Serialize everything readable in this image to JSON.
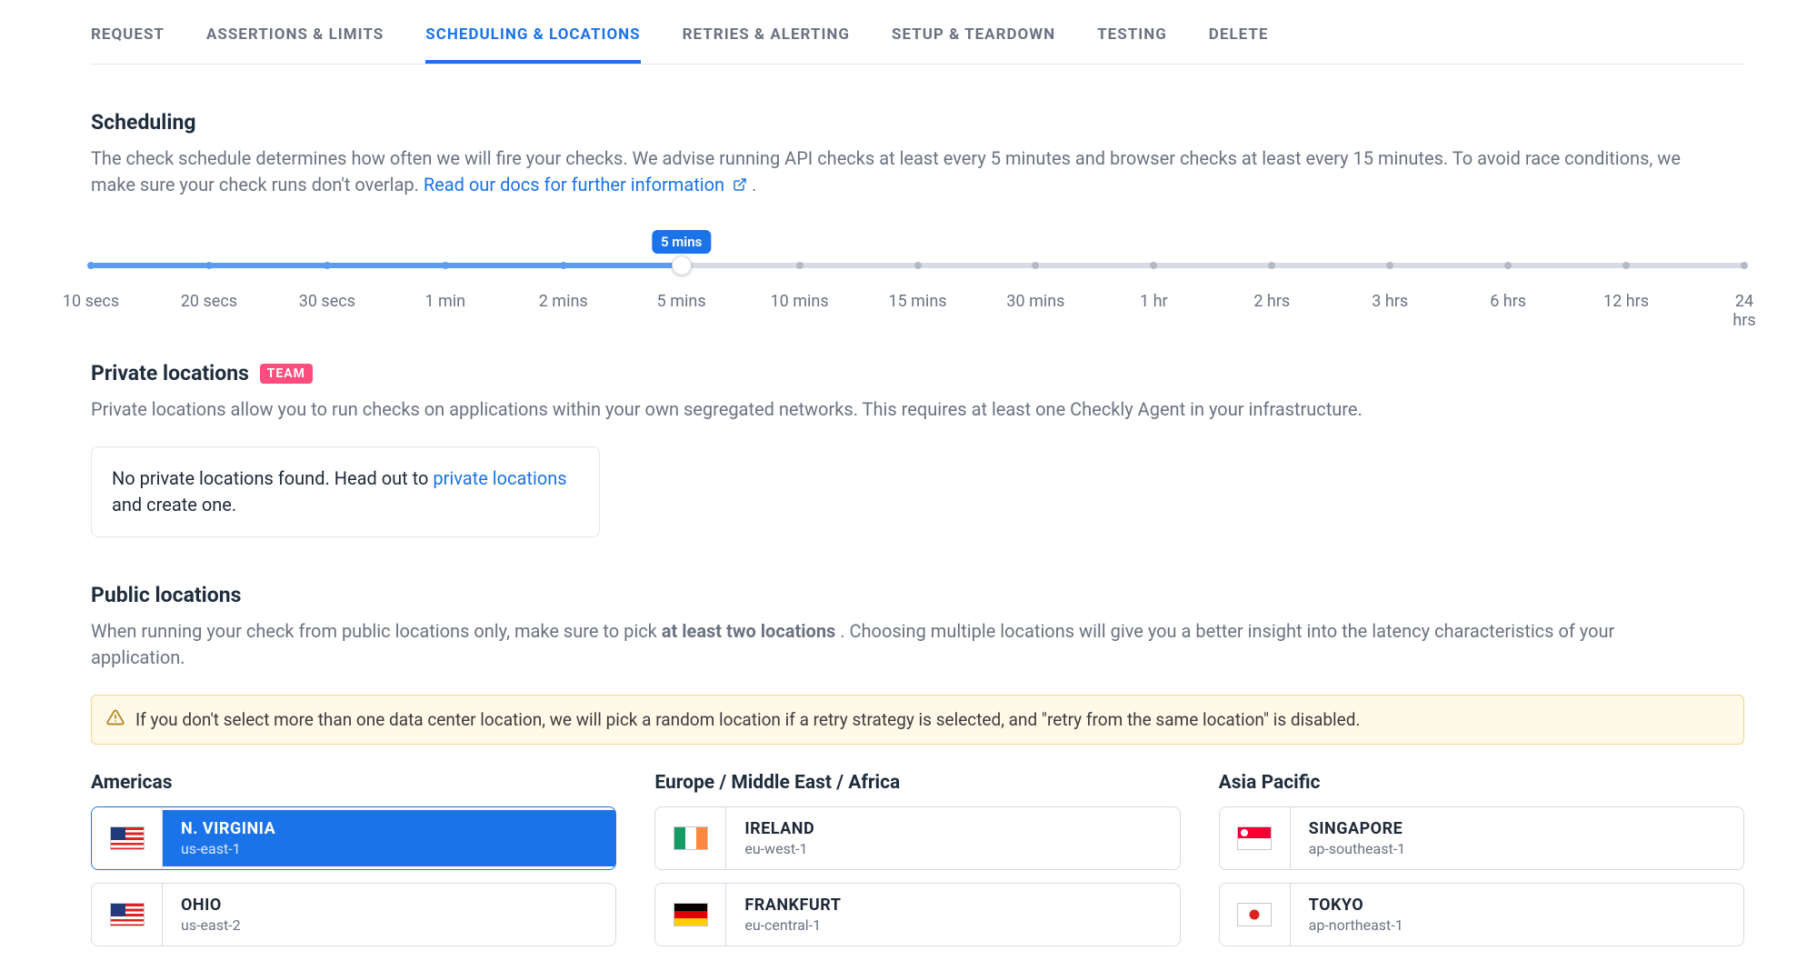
{
  "tabs": [
    {
      "label": "Request",
      "active": false
    },
    {
      "label": "Assertions & Limits",
      "active": false
    },
    {
      "label": "Scheduling & Locations",
      "active": true
    },
    {
      "label": "Retries & Alerting",
      "active": false
    },
    {
      "label": "Setup & Teardown",
      "active": false
    },
    {
      "label": "Testing",
      "active": false
    },
    {
      "label": "Delete",
      "active": false
    }
  ],
  "scheduling": {
    "heading": "Scheduling",
    "desc_a": "The check schedule determines how often we will fire your checks. We advise running API checks at least every 5 minutes and browser checks at least every 15 minutes. To avoid race conditions, we make sure your check runs don't overlap. ",
    "docs_link": "Read our docs for further information",
    "desc_b": ".",
    "slider": {
      "value_label": "5 mins",
      "selected_index": 5,
      "ticks": [
        "10 secs",
        "20 secs",
        "30 secs",
        "1 min",
        "2 mins",
        "5 mins",
        "10 mins",
        "15 mins",
        "30 mins",
        "1 hr",
        "2 hrs",
        "3 hrs",
        "6 hrs",
        "12 hrs",
        "24 hrs"
      ]
    }
  },
  "private_locations": {
    "heading": "Private locations",
    "badge": "TEAM",
    "desc": "Private locations allow you to run checks on applications within your own segregated networks. This requires at least one Checkly Agent in your infrastructure.",
    "empty_a": "No private locations found. Head out to ",
    "empty_link": "private locations",
    "empty_b": " and create one."
  },
  "public_locations": {
    "heading": "Public locations",
    "desc_a": "When running your check from public locations only, make sure to pick ",
    "desc_strong": "at least two locations",
    "desc_b": ". Choosing multiple locations will give you a better insight into the latency characteristics of your application.",
    "alert": "If you don't select more than one data center location, we will pick a random location if a retry strategy is selected, and \"retry from the same location\" is disabled."
  },
  "regions": [
    {
      "title": "Americas",
      "locations": [
        {
          "name": "N. Virginia",
          "id": "us-east-1",
          "flag": "us",
          "selected": true
        },
        {
          "name": "Ohio",
          "id": "us-east-2",
          "flag": "us",
          "selected": false
        }
      ]
    },
    {
      "title": "Europe / Middle East / Africa",
      "locations": [
        {
          "name": "Ireland",
          "id": "eu-west-1",
          "flag": "ie",
          "selected": false
        },
        {
          "name": "Frankfurt",
          "id": "eu-central-1",
          "flag": "de",
          "selected": false
        }
      ]
    },
    {
      "title": "Asia Pacific",
      "locations": [
        {
          "name": "Singapore",
          "id": "ap-southeast-1",
          "flag": "sg",
          "selected": false
        },
        {
          "name": "Tokyo",
          "id": "ap-northeast-1",
          "flag": "jp",
          "selected": false
        }
      ]
    }
  ]
}
